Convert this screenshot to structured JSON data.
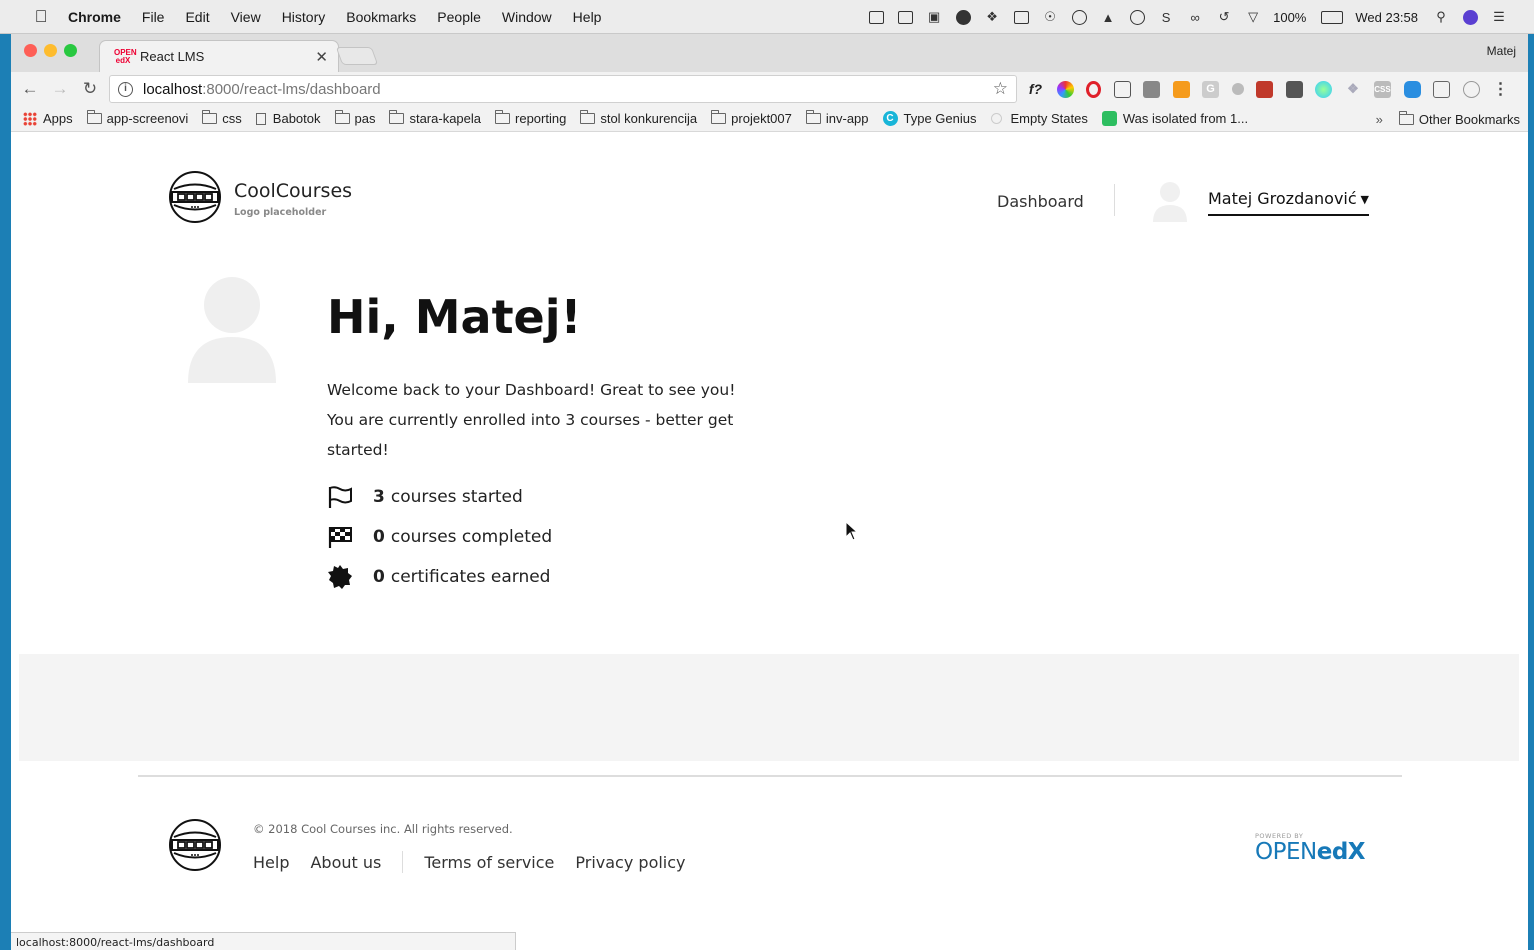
{
  "menubar": {
    "apple_icon": "apple-icon",
    "items": [
      "Chrome",
      "File",
      "Edit",
      "View",
      "History",
      "Bookmarks",
      "People",
      "Window",
      "Help"
    ],
    "battery": "100%",
    "clock": "Wed 23:58"
  },
  "browser": {
    "tab_title": "React LMS",
    "tab_favicon_text": "OPEN edX",
    "profile_name": "Matej",
    "url_host": "localhost",
    "url_path": ":8000/react-lms/dashboard",
    "bookmarks": [
      {
        "label": "Apps",
        "icon": "apps-icon"
      },
      {
        "label": "app-screenovi",
        "icon": "folder-icon"
      },
      {
        "label": "css",
        "icon": "folder-icon"
      },
      {
        "label": "Babotok",
        "icon": "page-icon"
      },
      {
        "label": "pas",
        "icon": "folder-icon"
      },
      {
        "label": "stara-kapela",
        "icon": "folder-icon"
      },
      {
        "label": "reporting",
        "icon": "folder-icon"
      },
      {
        "label": "stol konkurencija",
        "icon": "folder-icon"
      },
      {
        "label": "projekt007",
        "icon": "folder-icon"
      },
      {
        "label": "inv-app",
        "icon": "folder-icon"
      },
      {
        "label": "Type Genius",
        "icon": "type-genius-icon"
      },
      {
        "label": "Empty States",
        "icon": "empty-states-icon"
      },
      {
        "label": "Was isolated from 1...",
        "icon": "evernote-icon"
      }
    ],
    "bookmarks_overflow": "»",
    "other_bookmarks": "Other Bookmarks",
    "status_url": "localhost:8000/react-lms/dashboard",
    "accent_colors": {
      "close": "#fe5f57",
      "minimize": "#febc2e",
      "zoom": "#28c840"
    }
  },
  "site": {
    "logo_name": "CoolCourses",
    "logo_sub": "Logo placeholder",
    "nav_dashboard": "Dashboard",
    "user_name": "Matej Grozdanović",
    "greeting": "Hi, Matej!",
    "welcome_text": "Welcome back to your Dashboard! Great to see you! You are currently enrolled into 3 courses - better get started!",
    "stats": [
      {
        "icon": "flag-icon",
        "count": "3",
        "label": "courses started"
      },
      {
        "icon": "checkered-flag-icon",
        "count": "0",
        "label": "courses completed"
      },
      {
        "icon": "certificate-badge-icon",
        "count": "0",
        "label": "certificates earned"
      }
    ]
  },
  "footer": {
    "copyright": "© 2018 Cool Courses inc. All rights reserved.",
    "links": [
      "Help",
      "About us",
      "Terms of service",
      "Privacy policy"
    ],
    "powered_by": "POWERED BY",
    "openedx_open": "OPEN",
    "openedx_edx": "edX"
  }
}
